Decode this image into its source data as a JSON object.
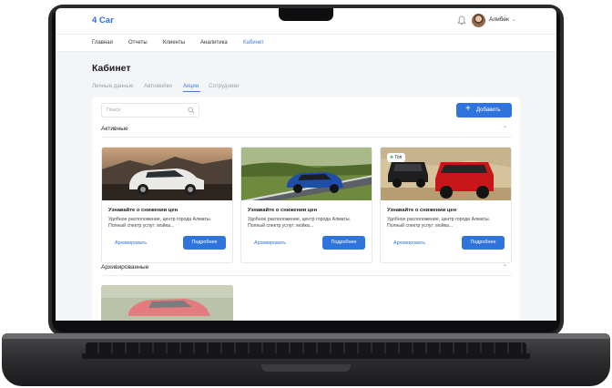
{
  "app": {
    "logo": "4 Car",
    "user_name": "Алибек"
  },
  "nav": {
    "items": [
      "Главная",
      "Отчеты",
      "Клиенты",
      "Аналитика",
      "Кабинет"
    ],
    "active": "Кабинет"
  },
  "page": {
    "title": "Кабинет"
  },
  "tabs": {
    "items": [
      "Личные данные",
      "Автомойки",
      "Акции",
      "Сотрудники"
    ],
    "active": "Акции"
  },
  "search": {
    "placeholder": "Поиск"
  },
  "add_button": {
    "label": "Добавить"
  },
  "sections": {
    "active": "Активные",
    "archived": "Архивированные"
  },
  "cards": [
    {
      "title": "Узнавайте о снижении цен",
      "description": "Удобное расположение, центр города Алматы. Полный спектр услуг: мойка...",
      "archive_label": "Архивировать",
      "details_label": "Подробнее",
      "badge": ""
    },
    {
      "title": "Узнавайте о снижении цен",
      "description": "Удобное расположение, центр города Алматы. Полный спектр услуг: мойка...",
      "archive_label": "Архивировать",
      "details_label": "Подробнее",
      "badge": ""
    },
    {
      "title": "Узнавайте о снижении цен",
      "description": "Удобное расположение, центр города Алматы. Полный спектр услуг: мойка...",
      "archive_label": "Архивировать",
      "details_label": "Подробнее",
      "badge": "Топ"
    }
  ],
  "colors": {
    "accent": "#2f74dc",
    "background": "#f4f5f7"
  }
}
